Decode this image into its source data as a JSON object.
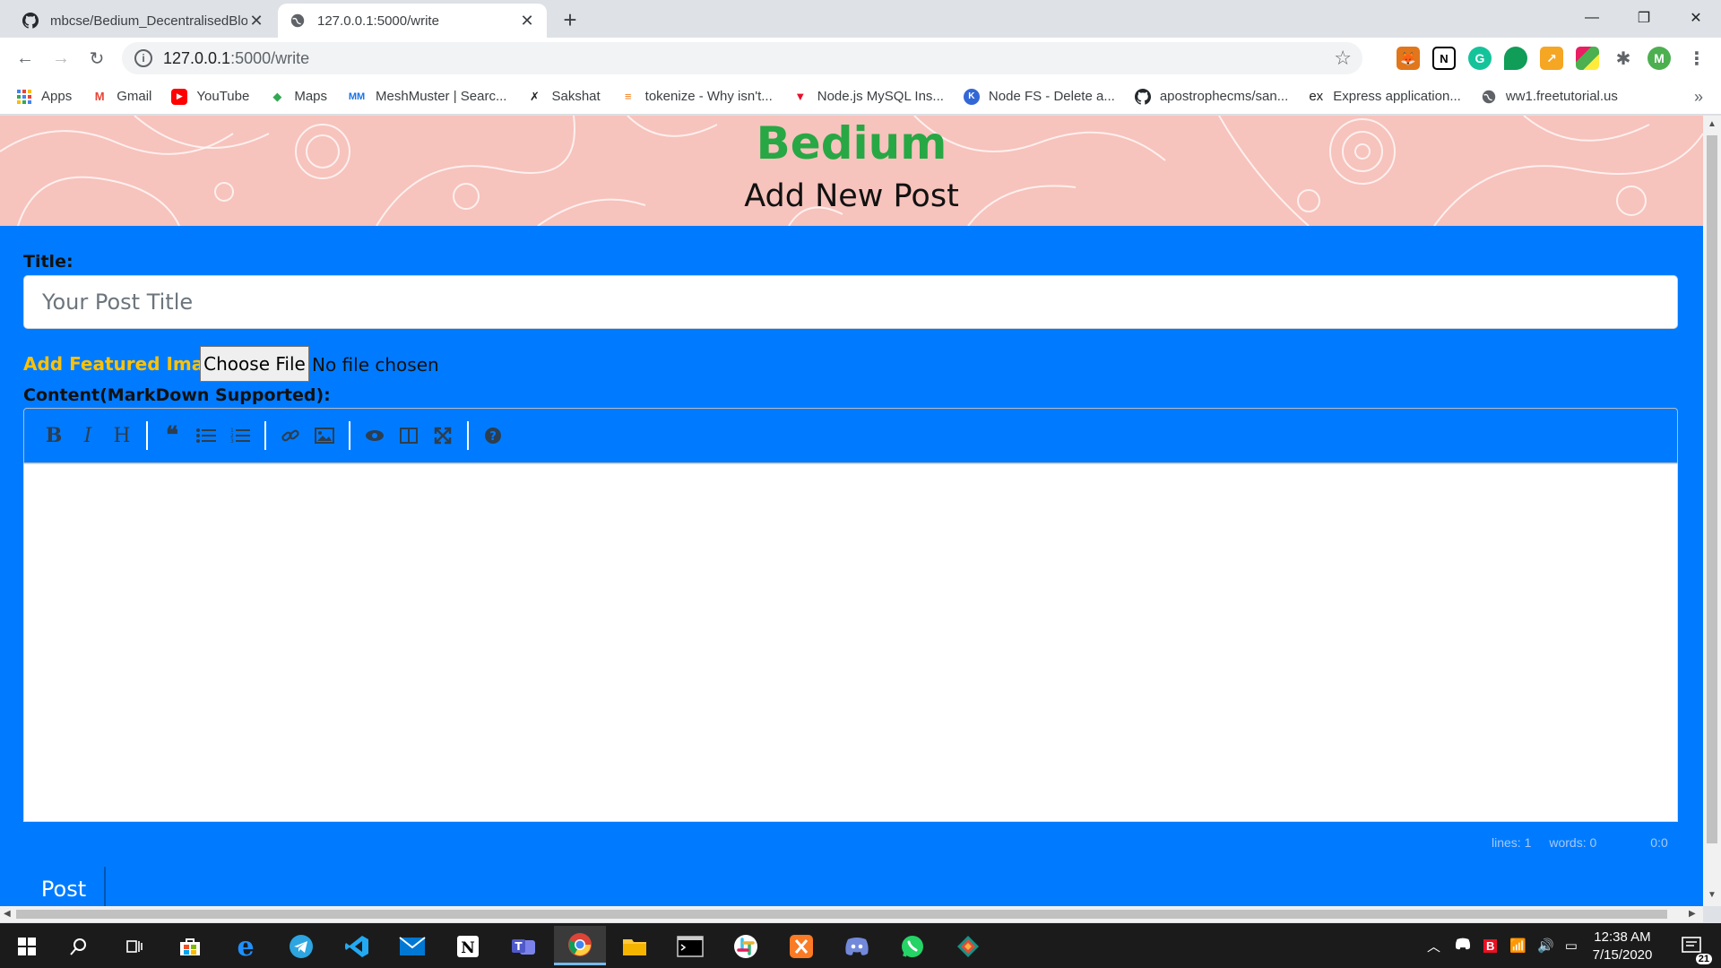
{
  "browser": {
    "tabs": [
      {
        "title": "mbcse/Bedium_DecentralisedBlo",
        "favicon": "github-icon",
        "active": false
      },
      {
        "title": "127.0.0.1:5000/write",
        "favicon": "globe-icon",
        "active": true
      }
    ],
    "address": {
      "host": "127.0.0.1",
      "path": ":5000/write"
    },
    "profile_initial": "M"
  },
  "bookmarks": [
    {
      "label": "Apps",
      "icon": "apps-grid-icon",
      "color": "#4285f4"
    },
    {
      "label": "Gmail",
      "icon": "gmail-icon",
      "color": "#ea4335"
    },
    {
      "label": "YouTube",
      "icon": "youtube-icon",
      "color": "#ff0000"
    },
    {
      "label": "Maps",
      "icon": "maps-icon",
      "color": "#34a853"
    },
    {
      "label": "MeshMuster | Searc...",
      "icon": "meshmuster-icon",
      "color": "#1a73e8"
    },
    {
      "label": "Sakshat",
      "icon": "sakshat-icon",
      "color": "#222222"
    },
    {
      "label": "tokenize - Why isn't...",
      "icon": "stackoverflow-icon",
      "color": "#f48024"
    },
    {
      "label": "Node.js MySQL Ins...",
      "icon": "tutorials-icon",
      "color": "#e8112d"
    },
    {
      "label": "Node FS - Delete a...",
      "icon": "node-fs-icon",
      "color": "#3367d6"
    },
    {
      "label": "apostrophecms/san...",
      "icon": "github-icon",
      "color": "#222222"
    },
    {
      "label": "Express application...",
      "icon": "express-icon",
      "color": "#222222"
    },
    {
      "label": "ww1.freetutorial.us",
      "icon": "globe-icon",
      "color": "#5f6368"
    }
  ],
  "page": {
    "brand": "Bedium",
    "heading": "Add New Post",
    "title_label": "Title:",
    "title_placeholder": "Your Post Title",
    "featured_label": "Add Featured Image",
    "file_button": "Choose File",
    "file_status": "No file chosen",
    "content_label": "Content(MarkDown Supported):",
    "editor_status": {
      "lines": "lines: 1",
      "words": "words: 0",
      "cursor": "0:0"
    },
    "post_button": "Post",
    "colors": {
      "page_bg": "#007bff",
      "brand": "#28a745",
      "banner": "#f7c3bd",
      "featured": "#ffc107"
    }
  },
  "taskbar": {
    "time": "12:38 AM",
    "date": "7/15/2020",
    "notification_count": "21"
  }
}
